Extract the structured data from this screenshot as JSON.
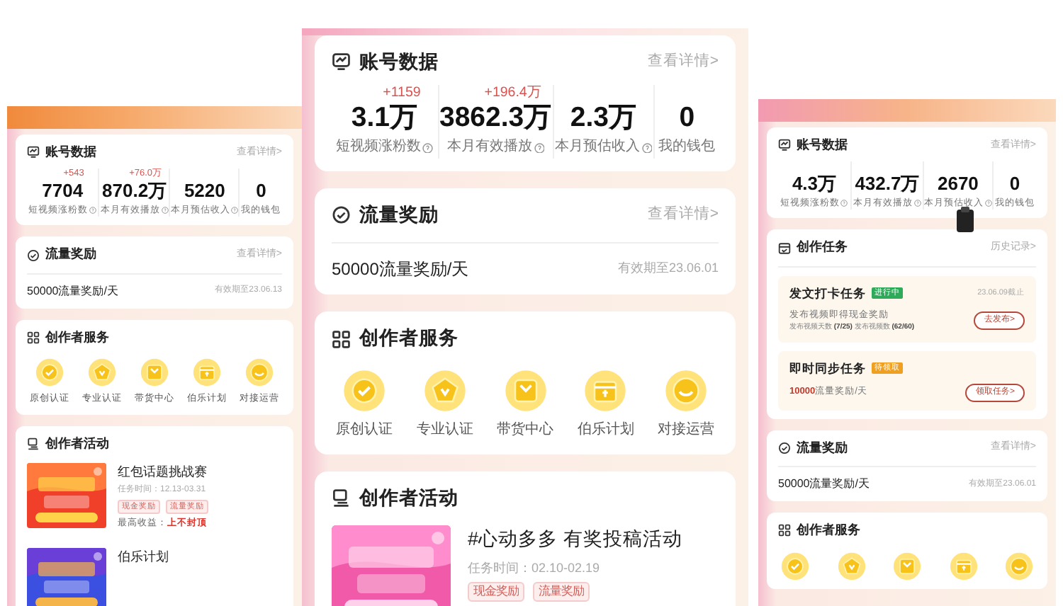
{
  "panels": [
    {
      "sections": [
        {
          "kind": "stats",
          "title": "账号数据",
          "link": "查看详情>",
          "stats": [
            {
              "delta": "+543",
              "value": "7704",
              "label": "短视频涨粉数",
              "info": true
            },
            {
              "delta": "+76.0万",
              "value": "870.2万",
              "label": "本月有效播放",
              "info": true
            },
            {
              "value": "5220",
              "label": "本月预估收入",
              "info": true
            },
            {
              "value": "0",
              "label": "我的钱包",
              "info": false
            }
          ]
        },
        {
          "kind": "reward",
          "title": "流量奖励",
          "link": "查看详情>",
          "text": "50000流量奖励/天",
          "expiry": "有效期至23.06.13"
        },
        {
          "kind": "services",
          "title": "创作者服务",
          "items": [
            {
              "kind": "check",
              "label": "原创认证"
            },
            {
              "kind": "pentagon",
              "label": "专业认证"
            },
            {
              "kind": "bag",
              "label": "带货中心"
            },
            {
              "kind": "gift",
              "label": "伯乐计划"
            },
            {
              "kind": "smile",
              "label": "对接运营"
            }
          ]
        },
        {
          "kind": "activities",
          "title": "创作者活动",
          "items": [
            {
              "title": "红包话题挑战赛",
              "time": "任务时间：12.13-03.31",
              "tags": [
                "现金奖励",
                "流量奖励"
              ],
              "earning": "最高收益：**上不封顶**"
            },
            {
              "title": "伯乐计划"
            }
          ]
        }
      ]
    },
    {
      "sections": [
        {
          "kind": "stats",
          "title": "账号数据",
          "link": "查看详情>",
          "stats": [
            {
              "delta": "+1159",
              "value": "3.1万",
              "label": "短视频涨粉数",
              "info": true
            },
            {
              "delta": "+196.4万",
              "value": "3862.3万",
              "label": "本月有效播放",
              "info": true
            },
            {
              "value": "2.3万",
              "label": "本月预估收入",
              "info": true
            },
            {
              "value": "0",
              "label": "我的钱包",
              "info": false
            }
          ]
        },
        {
          "kind": "reward",
          "title": "流量奖励",
          "link": "查看详情>",
          "text": "50000流量奖励/天",
          "expiry": "有效期至23.06.01"
        },
        {
          "kind": "services",
          "title": "创作者服务",
          "items": [
            {
              "kind": "check",
              "label": "原创认证"
            },
            {
              "kind": "pentagon",
              "label": "专业认证"
            },
            {
              "kind": "bag",
              "label": "带货中心"
            },
            {
              "kind": "gift",
              "label": "伯乐计划"
            },
            {
              "kind": "smile",
              "label": "对接运营"
            }
          ]
        },
        {
          "kind": "activities",
          "title": "创作者活动",
          "items": [
            {
              "title": "#心动多多 有奖投稿活动",
              "time": "任务时间：02.10-02.19",
              "tags": [
                "现金奖励",
                "流量奖励"
              ]
            }
          ]
        }
      ]
    },
    {
      "sections": [
        {
          "kind": "stats",
          "title": "账号数据",
          "link": "查看详情>",
          "stats": [
            {
              "value": "4.3万",
              "label": "短视频涨粉数",
              "info": true
            },
            {
              "value": "432.7万",
              "label": "本月有效播放",
              "info": true
            },
            {
              "value": "2670",
              "label": "本月预估收入",
              "info": true
            },
            {
              "value": "0",
              "label": "我的钱包",
              "info": false
            }
          ]
        },
        {
          "kind": "tasks",
          "title": "创作任务",
          "link": "历史记录>",
          "tasks": [
            {
              "title": "发文打卡任务",
              "status": "进行中",
              "color": "#2faa5a",
              "deadline": "23.06.09截止",
              "desc": "发布视频即得现金奖励",
              "progress": "发布视频天数 **(7/25)** 发布视频数 **(62/60)**",
              "action": "去发布>"
            },
            {
              "title": "即时同步任务",
              "status": "待领取",
              "color": "#f0a020",
              "desc": "**10000**流量奖励/天",
              "action": "领取任务>"
            }
          ]
        },
        {
          "kind": "reward",
          "title": "流量奖励",
          "link": "查看详情>",
          "text": "50000流量奖励/天",
          "expiry": "有效期至23.06.01"
        },
        {
          "kind": "services",
          "title": "创作者服务",
          "items": [
            {
              "kind": "check"
            },
            {
              "kind": "pentagon"
            },
            {
              "kind": "bag"
            },
            {
              "kind": "gift"
            },
            {
              "kind": "smile"
            }
          ]
        }
      ]
    }
  ]
}
